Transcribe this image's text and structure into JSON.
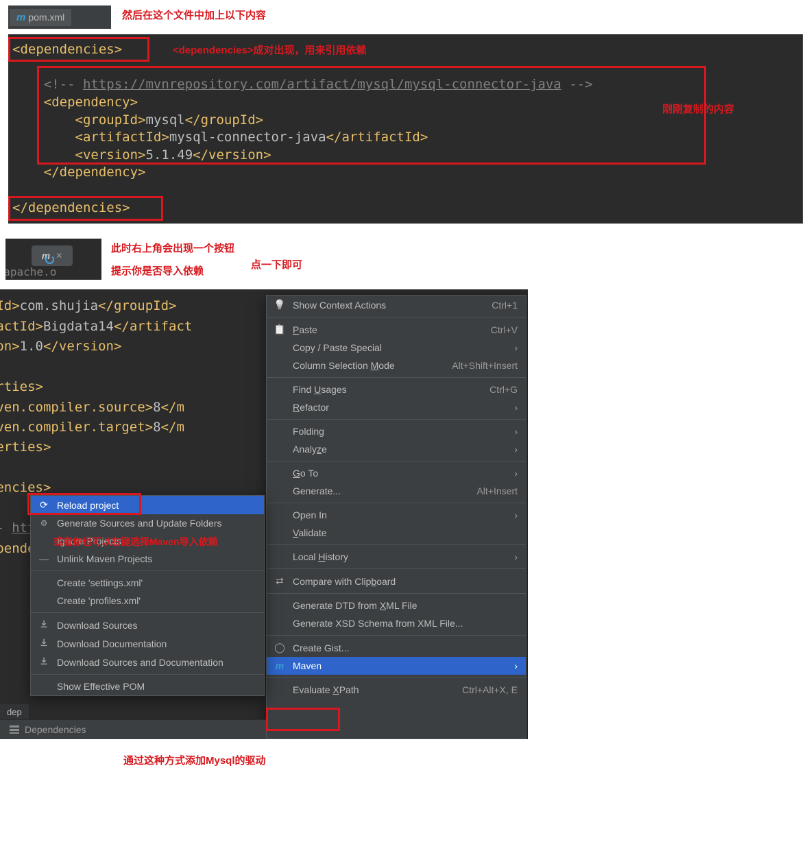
{
  "top_tab": {
    "file": "pom.xml"
  },
  "captions": {
    "add_in_file": "然后在这个文件中加上以下内容",
    "deps_pair": "<dependencies>成对出现，用来引用依赖",
    "copied": "刚刚复制的内容",
    "button_appears": "此时右上角会出现一个按钮",
    "import_hint": "提示你是否导入依赖",
    "click_once": "点一下即可",
    "or_right_click": "或者你也可以右键选择Maven导入依赖",
    "final": "通过这种方式添加Mysql的驱动"
  },
  "code1": {
    "deps_open": "dependencies",
    "comment_prefix": "<!-- ",
    "comment_url": "https://mvnrepository.com/artifact/mysql/mysql-connector-java",
    "comment_suffix": " -->",
    "dep": "dependency",
    "group": "groupId",
    "group_val": "mysql",
    "art": "artifactId",
    "art_val": "mysql-connector-java",
    "ver": "version",
    "ver_val": "5.1.49",
    "deps_close": "dependencies"
  },
  "mini_text": "n.apache.o",
  "code3": {
    "line1": {
      "tag": "oupId",
      "val": "com.shujia",
      "close": "groupId"
    },
    "line2": {
      "tag": "tifactId",
      "val": "Bigdata14",
      "close": "artifact"
    },
    "line3": {
      "tag": "rsion",
      "val": "1.0",
      "close": "version"
    },
    "prop_open": "operties",
    "mcs": "maven.compiler.source",
    "mct": "maven.compiler.target",
    "eight": "8",
    "m_partial_end": "m",
    "prop_close": "roperties",
    "deps_open_partial": "endencies",
    "comment_partial": "<!-- https://mvnrepository.",
    "dep_open": "dependency",
    "dep_close2": "</>",
    "last_partial1": "ep",
    "last_partial2": "ct"
  },
  "menu_main": [
    {
      "ico": "bulb",
      "label": "Show Context Actions",
      "sc": "Ctrl+1"
    },
    {
      "sep": true
    },
    {
      "ico": "paste",
      "label": "Paste",
      "u": "P",
      "sc": "Ctrl+V"
    },
    {
      "label": "Copy / Paste Special",
      "sub": true
    },
    {
      "label": "Column Selection Mode",
      "u": "M",
      "sc": "Alt+Shift+Insert"
    },
    {
      "sep": true
    },
    {
      "label": "Find Usages",
      "u": "U",
      "sc": "Ctrl+G"
    },
    {
      "label": "Refactor",
      "u": "R",
      "sub": true
    },
    {
      "sep": true
    },
    {
      "label": "Folding",
      "sub": true
    },
    {
      "label": "Analyze",
      "u": "z",
      "sub": true
    },
    {
      "sep": true
    },
    {
      "label": "Go To",
      "u": "G",
      "sub": true
    },
    {
      "label": "Generate...",
      "sc": "Alt+Insert"
    },
    {
      "sep": true
    },
    {
      "label": "Open In",
      "sub": true
    },
    {
      "label": "Validate",
      "u": "V"
    },
    {
      "sep": true
    },
    {
      "label": "Local History",
      "u": "H",
      "sub": true
    },
    {
      "sep": true
    },
    {
      "ico": "compare",
      "label": "Compare with Clipboard",
      "u": "b"
    },
    {
      "sep": true
    },
    {
      "label": "Generate DTD from XML File",
      "u": "X"
    },
    {
      "label": "Generate XSD Schema from XML File..."
    },
    {
      "sep": true
    },
    {
      "ico": "github",
      "label": "Create Gist..."
    },
    {
      "ico": "m",
      "label": "Maven",
      "sel": true,
      "sub": true
    },
    {
      "sep": true
    },
    {
      "label": "Evaluate XPath",
      "u": "X",
      "sc": "Ctrl+Alt+X, E"
    }
  ],
  "menu_maven": [
    {
      "ico": "reload",
      "label": "Reload project",
      "sel": true
    },
    {
      "ico": "gen",
      "label": "Generate Sources and Update Folders"
    },
    {
      "label": "Ignore Projects"
    },
    {
      "ico": "unlink",
      "label": "Unlink Maven Projects"
    },
    {
      "sep": true
    },
    {
      "label": "Create 'settings.xml'"
    },
    {
      "label": "Create 'profiles.xml'"
    },
    {
      "sep": true
    },
    {
      "ico": "dl",
      "label": "Download Sources"
    },
    {
      "ico": "dl",
      "label": "Download Documentation"
    },
    {
      "ico": "dl",
      "label": "Download Sources and Documentation"
    },
    {
      "sep": true
    },
    {
      "label": "Show Effective POM"
    }
  ],
  "bottom": {
    "dep_tab": "dep",
    "dep_strip": "Dependencies"
  }
}
